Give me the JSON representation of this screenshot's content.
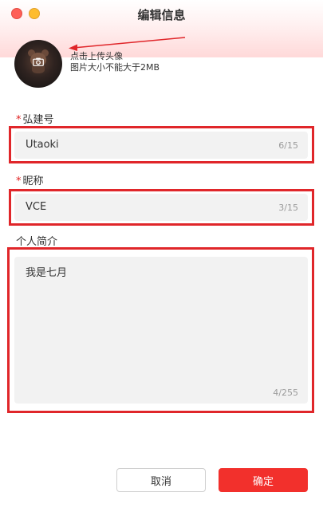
{
  "window": {
    "title": "编辑信息"
  },
  "avatar": {
    "upload_line1": "点击上传头像",
    "upload_line2": "图片大小不能大于2MB",
    "icon": "camera-icon"
  },
  "fields": {
    "account": {
      "label": "弘建号",
      "required_mark": "*",
      "value": "Utaoki",
      "counter": "6/15"
    },
    "nickname": {
      "label": "昵称",
      "required_mark": "*",
      "value": "VCE",
      "counter": "3/15"
    },
    "bio": {
      "label": "个人简介",
      "value": "我是七月",
      "counter": "4/255"
    }
  },
  "buttons": {
    "cancel": "取消",
    "confirm": "确定"
  },
  "colors": {
    "accent": "#f2302c",
    "highlight": "#e0262a",
    "field_bg": "#f2f2f2"
  }
}
